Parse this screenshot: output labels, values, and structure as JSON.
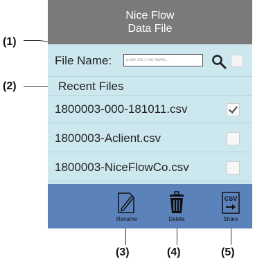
{
  "header": {
    "line1": "Nice Flow",
    "line2": "Data File"
  },
  "file_name": {
    "label": "File Name:",
    "placeholder": "Enter SN / File Name...",
    "search_icon": "search-icon"
  },
  "recent": {
    "label": "Recent Files"
  },
  "files": [
    {
      "name": "1800003-000-181011.csv",
      "checked": true
    },
    {
      "name": "1800003-Aclient.csv",
      "checked": false
    },
    {
      "name": "1800003-NiceFlowCo.csv",
      "checked": false
    }
  ],
  "toolbar": {
    "rename_label": "Rename",
    "delete_label": "Delete",
    "share_label": "Share",
    "share_icon_text": "CSV"
  },
  "callouts": {
    "c1": "(1)",
    "c2": "(2)",
    "c3": "(3)",
    "c4": "(4)",
    "c5": "(5)"
  },
  "colors": {
    "header": "#7a7a7a",
    "panel": "#cde7ee",
    "toolbar": "#5b82bb"
  }
}
